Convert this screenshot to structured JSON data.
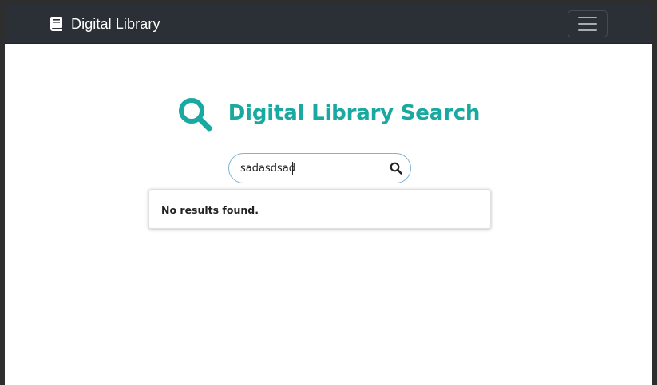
{
  "navbar": {
    "brand_text": "Digital Library",
    "brand_icon": "book-icon",
    "toggler_icon": "hamburger-menu-icon"
  },
  "hero": {
    "title": "Digital Library Search",
    "icon": "search-icon",
    "accent_color": "#1aa9a0"
  },
  "search": {
    "value": "sadasdsad",
    "button_icon": "search-icon"
  },
  "results": {
    "message": "No results found."
  },
  "colors": {
    "navbar_bg": "#2a3035",
    "accent": "#1aa9a0",
    "input_border": "#7fb3d2"
  }
}
